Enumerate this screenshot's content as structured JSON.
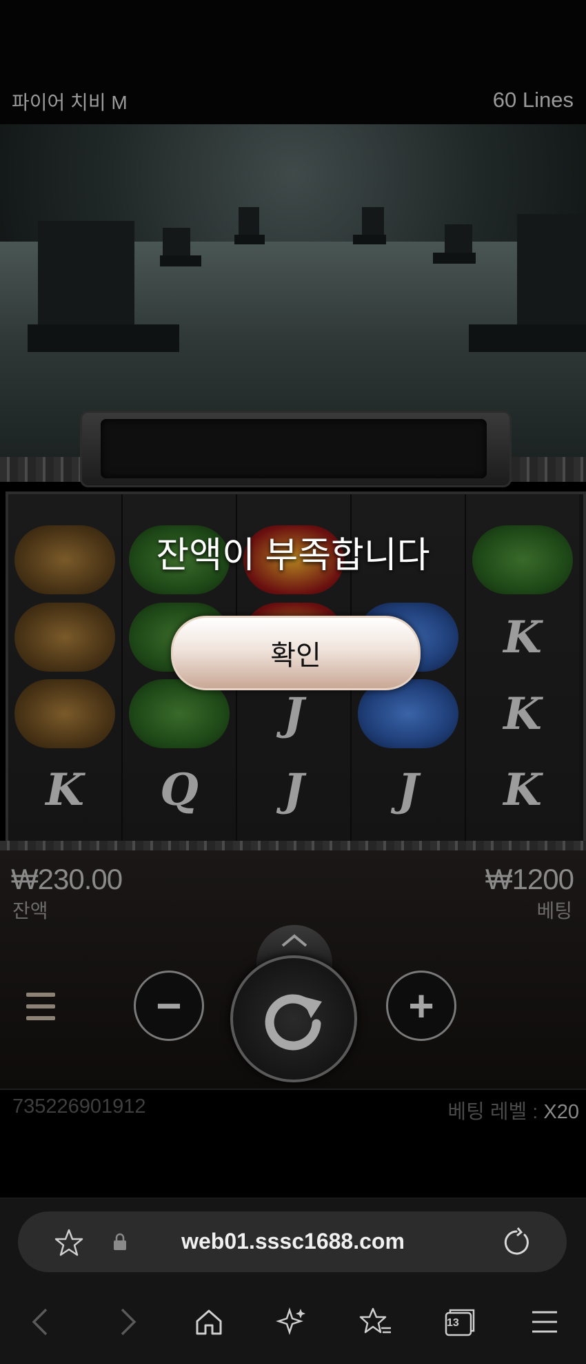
{
  "game": {
    "title": "파이어 치비 M",
    "lines": "60 Lines"
  },
  "reels": {
    "columns": [
      [
        "straw-armor",
        "straw-armor",
        "straw-armor",
        "K"
      ],
      [
        "bow-quiver",
        "bow-quiver",
        "bow-quiver",
        "Q"
      ],
      [
        "golden-tiger",
        "golden-tiger",
        "J",
        "J"
      ],
      [
        "fan",
        "fan",
        "fan",
        "J"
      ],
      [
        "bow-quiver",
        "K",
        "K",
        "K"
      ]
    ]
  },
  "modal": {
    "message": "잔액이 부족합니다",
    "confirm_label": "확인"
  },
  "balance": {
    "value": "₩230.00",
    "label": "잔액"
  },
  "bet": {
    "value": "₩1200",
    "label": "베팅"
  },
  "controls": {
    "minus": "−",
    "plus": "+"
  },
  "footer": {
    "game_id": "735226901912",
    "bet_level_label": "베팅 레벨 :",
    "bet_level_value": "X20"
  },
  "browser": {
    "url": "web01.sssc1688.com",
    "tab_count": "13"
  },
  "colors": {
    "accent_confirm": "#f0e4dc",
    "background": "#000000"
  }
}
